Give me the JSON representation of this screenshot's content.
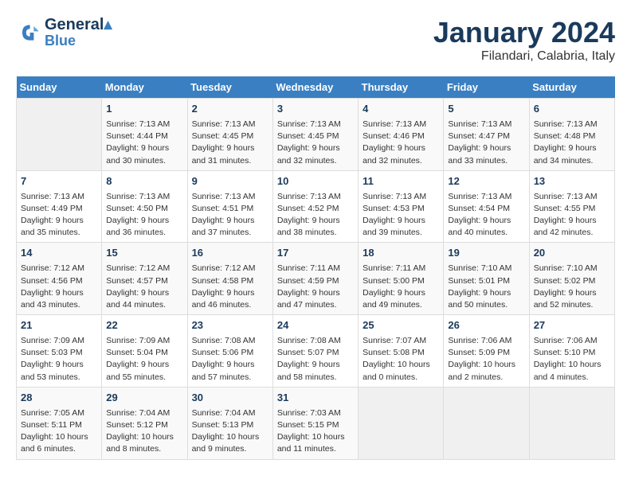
{
  "header": {
    "logo_line1": "General",
    "logo_line2": "Blue",
    "month": "January 2024",
    "location": "Filandari, Calabria, Italy"
  },
  "weekdays": [
    "Sunday",
    "Monday",
    "Tuesday",
    "Wednesday",
    "Thursday",
    "Friday",
    "Saturday"
  ],
  "weeks": [
    [
      {
        "day": "",
        "info": ""
      },
      {
        "day": "1",
        "info": "Sunrise: 7:13 AM\nSunset: 4:44 PM\nDaylight: 9 hours\nand 30 minutes."
      },
      {
        "day": "2",
        "info": "Sunrise: 7:13 AM\nSunset: 4:45 PM\nDaylight: 9 hours\nand 31 minutes."
      },
      {
        "day": "3",
        "info": "Sunrise: 7:13 AM\nSunset: 4:45 PM\nDaylight: 9 hours\nand 32 minutes."
      },
      {
        "day": "4",
        "info": "Sunrise: 7:13 AM\nSunset: 4:46 PM\nDaylight: 9 hours\nand 32 minutes."
      },
      {
        "day": "5",
        "info": "Sunrise: 7:13 AM\nSunset: 4:47 PM\nDaylight: 9 hours\nand 33 minutes."
      },
      {
        "day": "6",
        "info": "Sunrise: 7:13 AM\nSunset: 4:48 PM\nDaylight: 9 hours\nand 34 minutes."
      }
    ],
    [
      {
        "day": "7",
        "info": "Sunrise: 7:13 AM\nSunset: 4:49 PM\nDaylight: 9 hours\nand 35 minutes."
      },
      {
        "day": "8",
        "info": "Sunrise: 7:13 AM\nSunset: 4:50 PM\nDaylight: 9 hours\nand 36 minutes."
      },
      {
        "day": "9",
        "info": "Sunrise: 7:13 AM\nSunset: 4:51 PM\nDaylight: 9 hours\nand 37 minutes."
      },
      {
        "day": "10",
        "info": "Sunrise: 7:13 AM\nSunset: 4:52 PM\nDaylight: 9 hours\nand 38 minutes."
      },
      {
        "day": "11",
        "info": "Sunrise: 7:13 AM\nSunset: 4:53 PM\nDaylight: 9 hours\nand 39 minutes."
      },
      {
        "day": "12",
        "info": "Sunrise: 7:13 AM\nSunset: 4:54 PM\nDaylight: 9 hours\nand 40 minutes."
      },
      {
        "day": "13",
        "info": "Sunrise: 7:13 AM\nSunset: 4:55 PM\nDaylight: 9 hours\nand 42 minutes."
      }
    ],
    [
      {
        "day": "14",
        "info": "Sunrise: 7:12 AM\nSunset: 4:56 PM\nDaylight: 9 hours\nand 43 minutes."
      },
      {
        "day": "15",
        "info": "Sunrise: 7:12 AM\nSunset: 4:57 PM\nDaylight: 9 hours\nand 44 minutes."
      },
      {
        "day": "16",
        "info": "Sunrise: 7:12 AM\nSunset: 4:58 PM\nDaylight: 9 hours\nand 46 minutes."
      },
      {
        "day": "17",
        "info": "Sunrise: 7:11 AM\nSunset: 4:59 PM\nDaylight: 9 hours\nand 47 minutes."
      },
      {
        "day": "18",
        "info": "Sunrise: 7:11 AM\nSunset: 5:00 PM\nDaylight: 9 hours\nand 49 minutes."
      },
      {
        "day": "19",
        "info": "Sunrise: 7:10 AM\nSunset: 5:01 PM\nDaylight: 9 hours\nand 50 minutes."
      },
      {
        "day": "20",
        "info": "Sunrise: 7:10 AM\nSunset: 5:02 PM\nDaylight: 9 hours\nand 52 minutes."
      }
    ],
    [
      {
        "day": "21",
        "info": "Sunrise: 7:09 AM\nSunset: 5:03 PM\nDaylight: 9 hours\nand 53 minutes."
      },
      {
        "day": "22",
        "info": "Sunrise: 7:09 AM\nSunset: 5:04 PM\nDaylight: 9 hours\nand 55 minutes."
      },
      {
        "day": "23",
        "info": "Sunrise: 7:08 AM\nSunset: 5:06 PM\nDaylight: 9 hours\nand 57 minutes."
      },
      {
        "day": "24",
        "info": "Sunrise: 7:08 AM\nSunset: 5:07 PM\nDaylight: 9 hours\nand 58 minutes."
      },
      {
        "day": "25",
        "info": "Sunrise: 7:07 AM\nSunset: 5:08 PM\nDaylight: 10 hours\nand 0 minutes."
      },
      {
        "day": "26",
        "info": "Sunrise: 7:06 AM\nSunset: 5:09 PM\nDaylight: 10 hours\nand 2 minutes."
      },
      {
        "day": "27",
        "info": "Sunrise: 7:06 AM\nSunset: 5:10 PM\nDaylight: 10 hours\nand 4 minutes."
      }
    ],
    [
      {
        "day": "28",
        "info": "Sunrise: 7:05 AM\nSunset: 5:11 PM\nDaylight: 10 hours\nand 6 minutes."
      },
      {
        "day": "29",
        "info": "Sunrise: 7:04 AM\nSunset: 5:12 PM\nDaylight: 10 hours\nand 8 minutes."
      },
      {
        "day": "30",
        "info": "Sunrise: 7:04 AM\nSunset: 5:13 PM\nDaylight: 10 hours\nand 9 minutes."
      },
      {
        "day": "31",
        "info": "Sunrise: 7:03 AM\nSunset: 5:15 PM\nDaylight: 10 hours\nand 11 minutes."
      },
      {
        "day": "",
        "info": ""
      },
      {
        "day": "",
        "info": ""
      },
      {
        "day": "",
        "info": ""
      }
    ]
  ]
}
